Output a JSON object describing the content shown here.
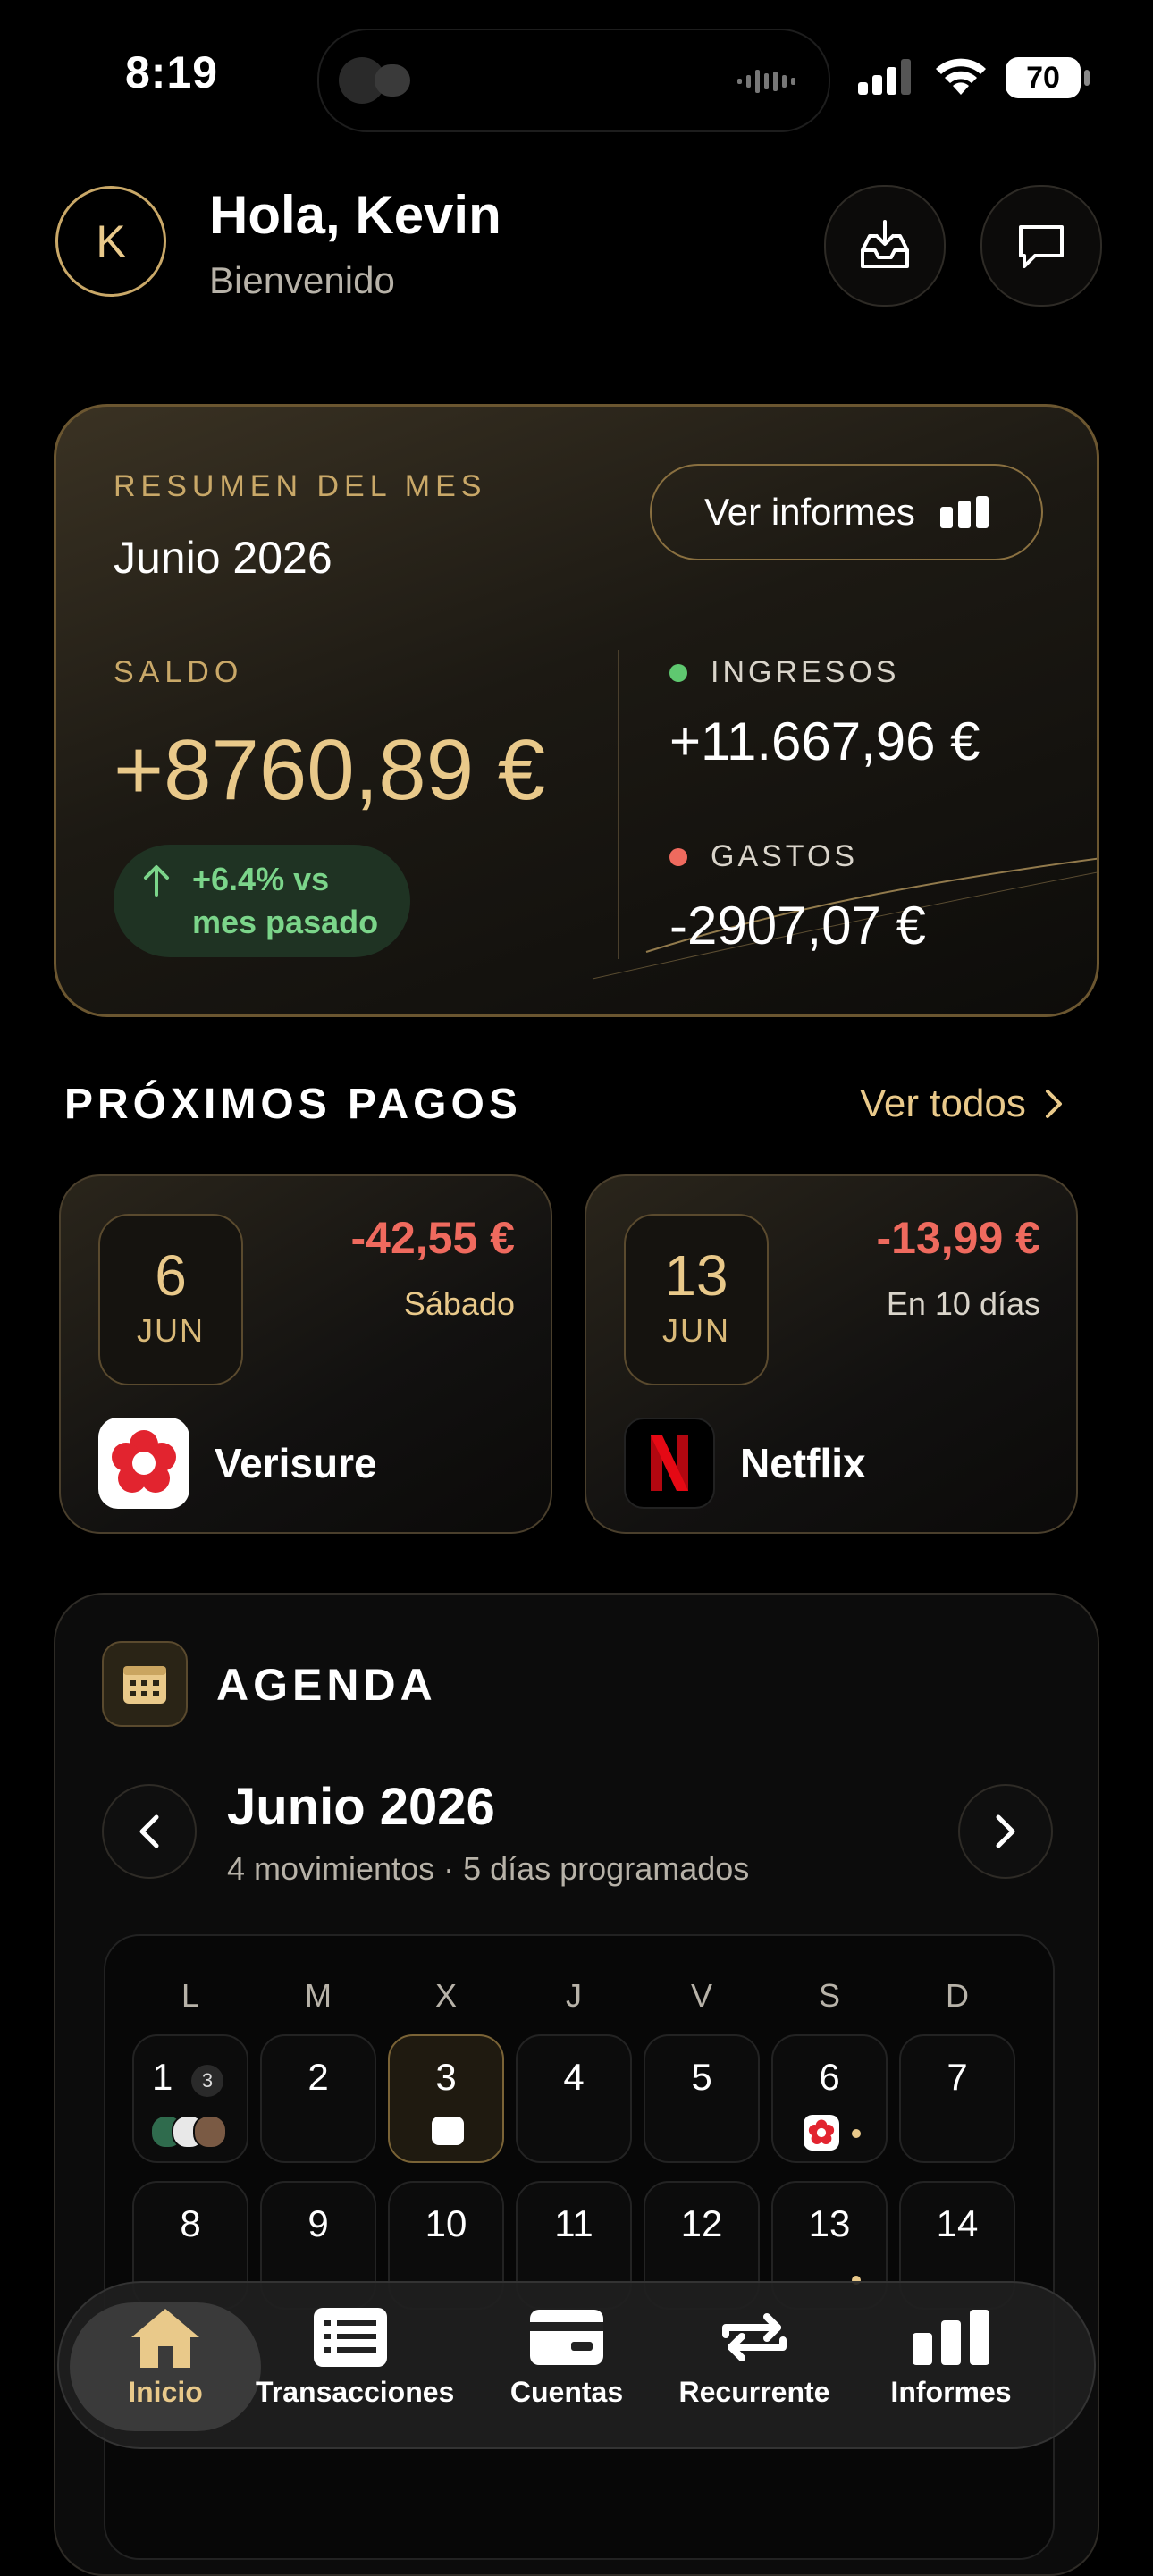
{
  "status": {
    "time": "8:19",
    "battery": "70"
  },
  "header": {
    "avatar_initial": "K",
    "greeting": "Hola, Kevin",
    "subtitle": "Bienvenido"
  },
  "summary": {
    "label": "RESUMEN DEL MES",
    "period": "Junio 2026",
    "report_button": "Ver informes",
    "balance_label": "SALDO",
    "balance": "+8760,89 €",
    "delta_line1": "+6.4% vs",
    "delta_line2": "mes pasado",
    "income_label": "INGRESOS",
    "income": "+11.667,96 €",
    "expenses_label": "GASTOS",
    "expenses": "-2907,07 €",
    "colors": {
      "income": "#5fc870",
      "expenses": "#ef6a5e",
      "gold": "#e9c98a"
    }
  },
  "upcoming": {
    "title": "PRÓXIMOS PAGOS",
    "see_all": "Ver todos",
    "payments": [
      {
        "day": "6",
        "month": "JUN",
        "amount": "-42,55 €",
        "when": "Sábado",
        "merchant": "Verisure",
        "logo": "verisure-logo"
      },
      {
        "day": "13",
        "month": "JUN",
        "amount": "-13,99 €",
        "when": "En 10 días",
        "merchant": "Netflix",
        "logo": "netflix-logo"
      }
    ]
  },
  "agenda": {
    "title": "AGENDA",
    "month": "Junio 2026",
    "subtitle": "4 movimientos · 5 días programados",
    "weekdays": [
      "L",
      "M",
      "X",
      "J",
      "V",
      "S",
      "D"
    ],
    "week1": [
      "1",
      "2",
      "3",
      "4",
      "5",
      "6",
      "7"
    ],
    "week2": [
      "8",
      "9",
      "10",
      "11",
      "12",
      "13",
      "14"
    ],
    "badge_day1": "3"
  },
  "tabs": [
    "Inicio",
    "Transacciones",
    "Cuentas",
    "Recurrente",
    "Informes"
  ]
}
